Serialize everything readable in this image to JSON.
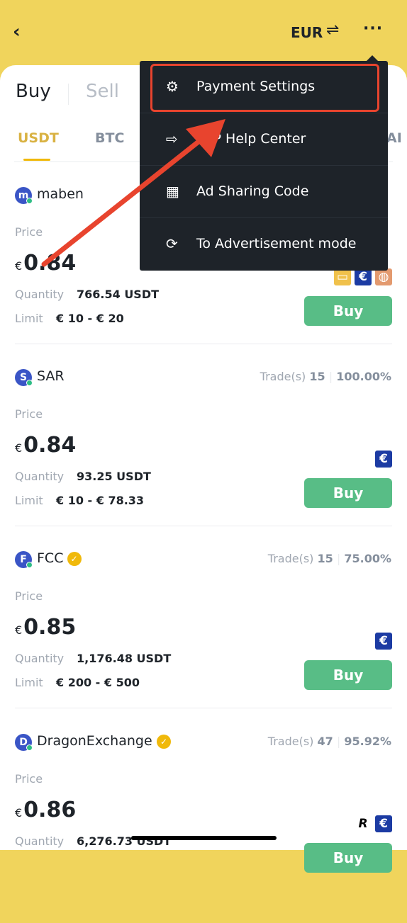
{
  "header": {
    "back": "‹",
    "currency": "EUR",
    "swap_icon": "⇌",
    "more": "···"
  },
  "trade_tabs": {
    "buy": "Buy",
    "sell": "Sell"
  },
  "coin_tabs": [
    "USDT",
    "BTC",
    "AI"
  ],
  "menu": [
    {
      "icon": "⚙",
      "label": "Payment Settings"
    },
    {
      "icon": "⇨",
      "label": "P2P Help Center"
    },
    {
      "icon": "▦",
      "label": "Ad Sharing Code"
    },
    {
      "icon": "⟳",
      "label": "To Advertisement mode"
    }
  ],
  "labels": {
    "price": "Price",
    "quantity": "Quantity",
    "limit": "Limit",
    "buy": "Buy",
    "currency_symbol": "€",
    "trades": "Trade(s)"
  },
  "ads": [
    {
      "initial": "m",
      "name": "maben",
      "verified": false,
      "trades": "",
      "completion": "",
      "price": "0.84",
      "quantity": "766.54 USDT",
      "limit": "€ 10 - € 20",
      "payments": [
        "card",
        "euro",
        "web"
      ]
    },
    {
      "initial": "S",
      "name": "SAR",
      "verified": false,
      "trades": "15",
      "completion": "100.00%",
      "price": "0.84",
      "quantity": "93.25 USDT",
      "limit": "€ 10 - € 78.33",
      "payments": [
        "euro"
      ]
    },
    {
      "initial": "F",
      "name": "FCC",
      "verified": true,
      "trades": "15",
      "completion": "75.00%",
      "price": "0.85",
      "quantity": "1,176.48 USDT",
      "limit": "€ 200 - € 500",
      "payments": [
        "euro"
      ]
    },
    {
      "initial": "D",
      "name": "DragonExchange",
      "verified": true,
      "trades": "47",
      "completion": "95.92%",
      "price": "0.86",
      "quantity": "6,276.73 USDT",
      "limit": "",
      "payments": [
        "revolut",
        "euro"
      ]
    }
  ],
  "colors": {
    "brand_yellow": "#F0D45C",
    "buy_green": "#58BD86",
    "annotation_red": "#E8442E",
    "menu_bg": "#1E2329"
  }
}
